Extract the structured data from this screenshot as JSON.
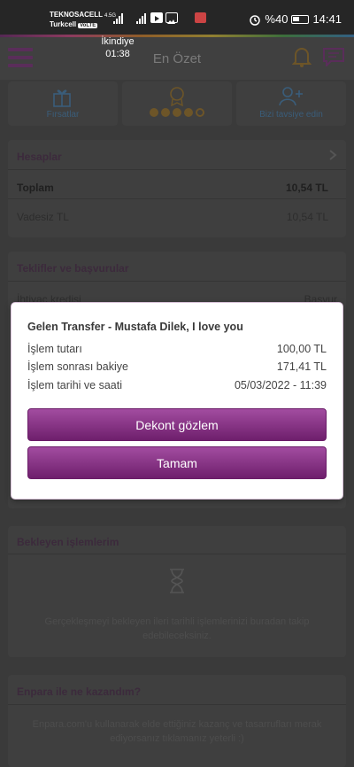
{
  "status_bar": {
    "carrier_1": "TEKNOSACELL",
    "carrier_2": "Turkcell",
    "volte": "VoLTE",
    "network": "4.5G",
    "alarm_icon": "alarm-icon",
    "battery_percent": "%40",
    "time": "14:41"
  },
  "prayer": {
    "name": "İkindiye",
    "time": "01:38"
  },
  "header": {
    "title": "En Özet",
    "menu_icon": "hamburger-icon",
    "bell_icon": "bell-icon",
    "chat_icon": "chat-icon",
    "accent": "#7b2a7a"
  },
  "quick_actions": [
    {
      "label": "Fırsatlar",
      "icon": "gift-icon"
    },
    {
      "label": "",
      "icon": "medal-icon",
      "level_filled": 4,
      "level_total": 5
    },
    {
      "label": "Bizi tavsiye edin",
      "icon": "add-user-icon"
    }
  ],
  "accounts": {
    "title": "Hesaplar",
    "rows": [
      {
        "name": "Toplam",
        "amount": "10,54 TL"
      },
      {
        "name": "Vadesiz TL",
        "amount": "10,54 TL"
      }
    ]
  },
  "offers": {
    "title": "Teklifler ve başvurular",
    "item_label": "İhtiyaç kredisi",
    "item_action": "Başvur"
  },
  "pending": {
    "title": "Bekleyen işlemlerim",
    "icon": "hourglass-icon",
    "message": "Gerçekleşmeyi bekleyen ileri tarihli işlemlerinizi buradan takip edebileceksiniz."
  },
  "gains": {
    "title": "Enpara ile ne kazandım?",
    "message": "Enpara.com'u kullanarak elde ettiğiniz kazanç ve tasarrufları merak ediyorsanız tıklamanız yeterli :)"
  },
  "dialog": {
    "title": "Gelen Transfer - Mustafa Dilek, I love you",
    "rows": [
      {
        "label": "İşlem tutarı",
        "value": "100,00 TL"
      },
      {
        "label": "İşlem sonrası bakiye",
        "value": "171,41 TL"
      },
      {
        "label": "İşlem tarihi ve saati",
        "value": "05/03/2022 - 11:39"
      }
    ],
    "primary_button": "Dekont gözlem",
    "secondary_button": "Tamam",
    "button_color": "#8a3388"
  }
}
